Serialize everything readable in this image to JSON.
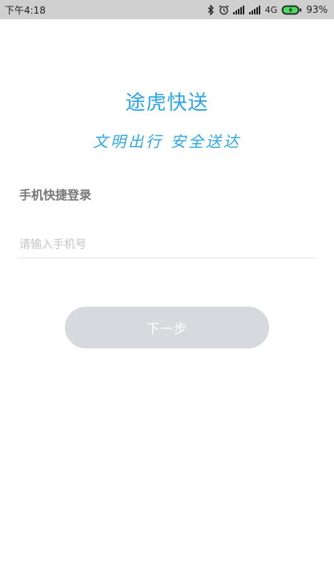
{
  "status_bar": {
    "time": "下午4:18",
    "network_label": "4G",
    "battery": "93%",
    "icons": [
      "bluetooth-icon",
      "alarm-icon",
      "signal-icon",
      "signal-icon",
      "battery-charging-icon"
    ]
  },
  "app": {
    "title": "途虎快送",
    "slogan": "文明出行 安全送达"
  },
  "login": {
    "section_label": "手机快捷登录",
    "phone_placeholder": "请输入手机号",
    "phone_value": "",
    "next_label": "下一步"
  },
  "colors": {
    "accent": "#2ca6e0",
    "button_disabled": "#d6d9dd",
    "status_bar_bg": "#cfcfcf"
  }
}
